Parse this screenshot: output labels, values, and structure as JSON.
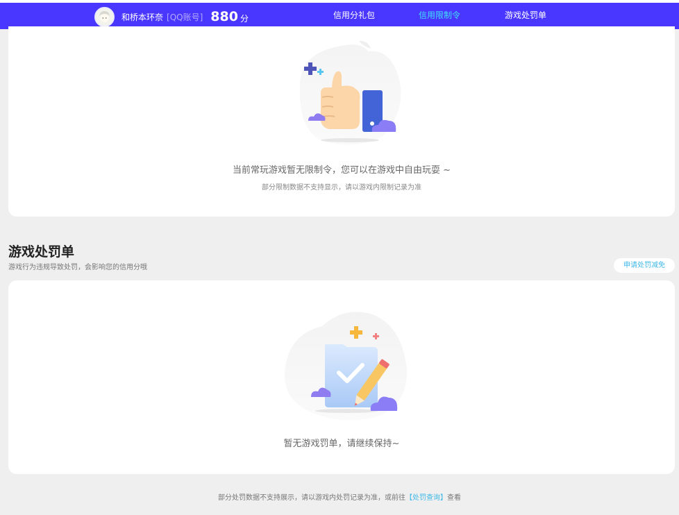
{
  "header": {
    "nickname": "和桥本环奈",
    "account_type": "[QQ账号]",
    "score": "880",
    "score_unit": "分",
    "tabs": [
      {
        "label": "信用分礼包",
        "active": false
      },
      {
        "label": "信用限制令",
        "active": true
      },
      {
        "label": "游戏处罚单",
        "active": false
      }
    ]
  },
  "restriction": {
    "empty_message": "当前常玩游戏暂无限制令，您可以在游戏中自由玩耍 ~",
    "empty_note": "部分限制数据不支持显示，请以游戏内限制记录为准"
  },
  "penalty": {
    "title": "游戏处罚单",
    "description": "游戏行为违规导致处罚，会影响您的信用分哦",
    "appeal_label": "申请处罚减免",
    "empty_message": "暂无游戏罚单，请继续保持~"
  },
  "footer": {
    "text_before": "部分处罚数据不支持展示，请以游戏内处罚记录为准，或前往",
    "link_label": "【处罚查询】",
    "text_after": "查看"
  },
  "colors": {
    "header_bg": "#4a37ff",
    "active_tab": "#3fe0ff",
    "link": "#3fb8e8",
    "page_bg": "#efefef"
  }
}
